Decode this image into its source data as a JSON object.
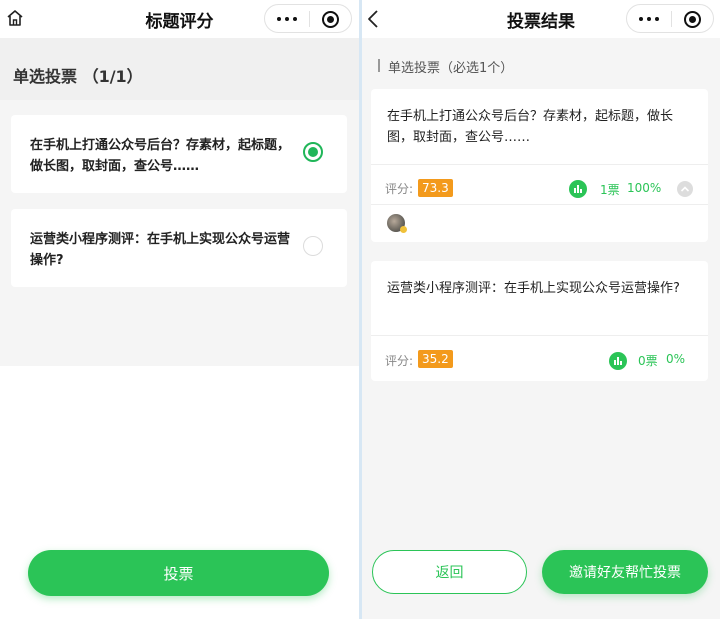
{
  "left": {
    "nav": {
      "title": "标题评分"
    },
    "section_title": "单选投票 （1/1）",
    "options": [
      {
        "text": "在手机上打通公众号后台？存素材，起标题，做长图，取封面，查公号……",
        "selected": true
      },
      {
        "text": "运营类小程序测评：在手机上实现公众号运营操作?",
        "selected": false
      }
    ],
    "vote_button": "投票"
  },
  "right": {
    "nav": {
      "title": "投票结果"
    },
    "subtitle": "单选投票（必选1个）",
    "results": [
      {
        "text": "在手机上打通公众号后台？存素材，起标题，做长图，取封面，查公号……",
        "score_label": "评分:",
        "score": "73.3",
        "votes": "1票",
        "percent": "100%"
      },
      {
        "text": "运营类小程序测评：在手机上实现公众号运营操作?",
        "score_label": "评分:",
        "score": "35.2",
        "votes": "0票",
        "percent": "0%"
      }
    ],
    "back_button": "返回",
    "invite_button": "邀请好友帮忙投票"
  },
  "colors": {
    "accent": "#2bc457",
    "score_badge": "#f39a1c"
  },
  "icons": [
    "home-icon",
    "back-icon",
    "more-icon",
    "target-icon",
    "bar-chart-icon",
    "collapse-icon"
  ]
}
